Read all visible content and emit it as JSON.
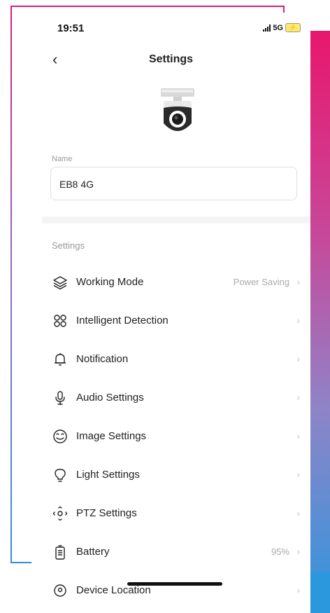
{
  "status": {
    "time": "19:51",
    "network": "5G"
  },
  "header": {
    "title": "Settings"
  },
  "name_field": {
    "label": "Name",
    "value": "EB8 4G"
  },
  "section_title": "Settings",
  "items": [
    {
      "label": "Working Mode",
      "value": "Power Saving",
      "icon": "layers-icon"
    },
    {
      "label": "Intelligent Detection",
      "value": "",
      "icon": "detection-icon"
    },
    {
      "label": "Notification",
      "value": "",
      "icon": "bell-icon"
    },
    {
      "label": "Audio Settings",
      "value": "",
      "icon": "microphone-icon"
    },
    {
      "label": "Image Settings",
      "value": "",
      "icon": "image-face-icon"
    },
    {
      "label": "Light Settings",
      "value": "",
      "icon": "lightbulb-icon"
    },
    {
      "label": "PTZ Settings",
      "value": "",
      "icon": "ptz-icon"
    },
    {
      "label": "Battery",
      "value": "95%",
      "icon": "battery-icon"
    },
    {
      "label": "Device Location",
      "value": "",
      "icon": "location-icon"
    }
  ],
  "colors": {
    "gradient_top": "#e8176d",
    "gradient_bottom": "#2f96dd",
    "frame_pink": "#d81b7a",
    "frame_blue": "#2f8fd6"
  }
}
